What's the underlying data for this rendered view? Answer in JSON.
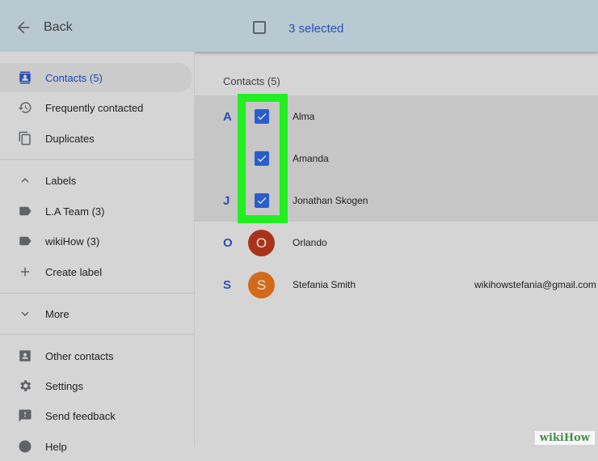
{
  "header": {
    "back_label": "Back",
    "selected_label": "3 selected"
  },
  "sidebar": {
    "items": [
      {
        "label": "Contacts (5)",
        "icon": "contacts-icon",
        "active": true
      },
      {
        "label": "Frequently contacted",
        "icon": "history-icon"
      },
      {
        "label": "Duplicates",
        "icon": "duplicates-icon"
      },
      {
        "label": "Labels",
        "icon": "chevron-up-icon"
      },
      {
        "label": "L.A Team (3)",
        "icon": "label-icon"
      },
      {
        "label": "wikiHow (3)",
        "icon": "label-icon"
      },
      {
        "label": "Create label",
        "icon": "plus-icon"
      },
      {
        "label": "More",
        "icon": "chevron-down-icon"
      },
      {
        "label": "Other contacts",
        "icon": "other-contacts-icon"
      },
      {
        "label": "Settings",
        "icon": "gear-icon"
      },
      {
        "label": "Send feedback",
        "icon": "feedback-icon"
      },
      {
        "label": "Help",
        "icon": "help-icon"
      }
    ]
  },
  "main": {
    "list_title": "Contacts (5)",
    "contacts": [
      {
        "letter": "A",
        "name": "Alma",
        "selected": true
      },
      {
        "letter": "",
        "name": "Amanda",
        "selected": true
      },
      {
        "letter": "J",
        "name": "Jonathan Skogen",
        "selected": true
      },
      {
        "letter": "O",
        "name": "Orlando",
        "selected": false,
        "initial": "O",
        "avatar_color": "#a8331a"
      },
      {
        "letter": "S",
        "name": "Stefania Smith",
        "selected": false,
        "initial": "S",
        "avatar_color": "#d5691a",
        "email": "wikihowstefania@gmail.com"
      }
    ]
  },
  "colors": {
    "accent": "#2a4fb3",
    "highlight": "#22ee22",
    "header_bg": "#b8c9d1"
  },
  "watermark": "wikiHow"
}
